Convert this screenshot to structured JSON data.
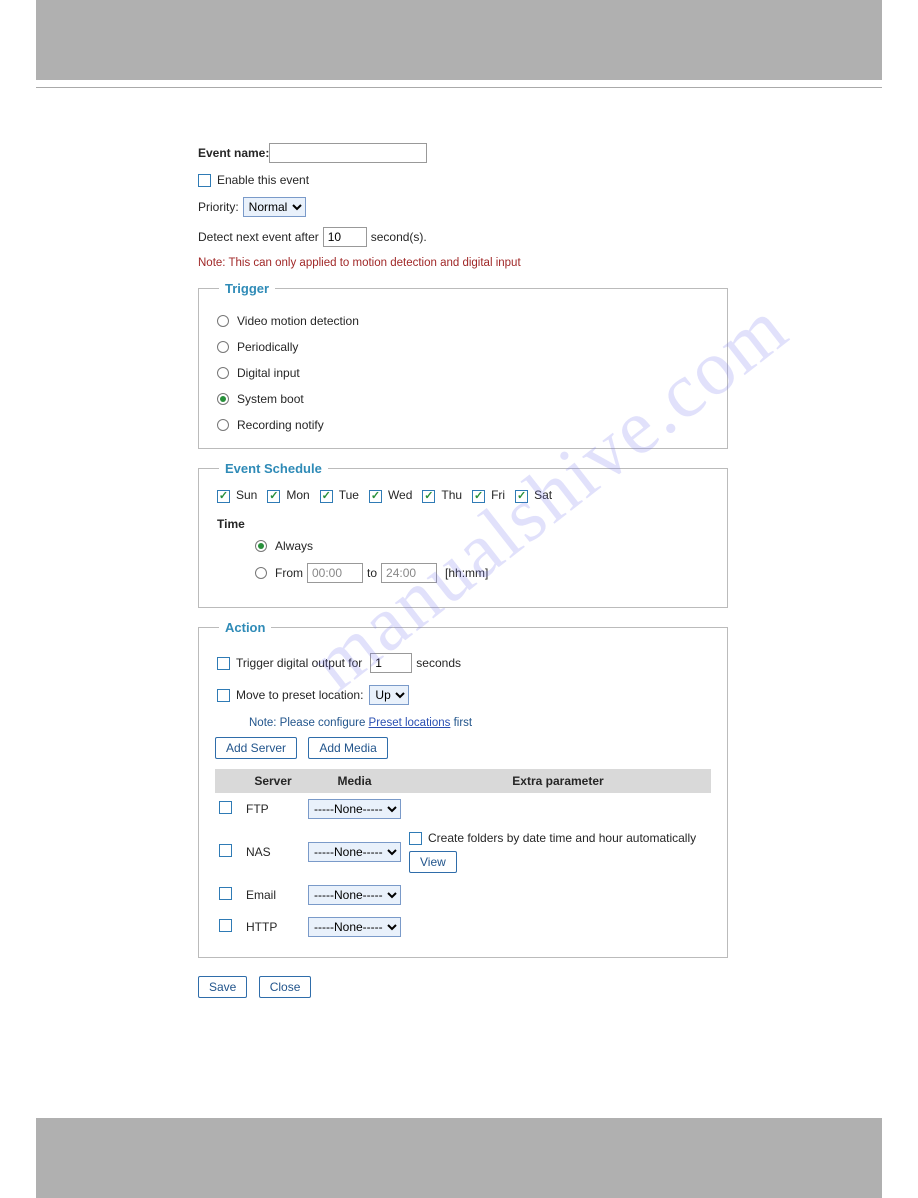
{
  "watermark": "manualshive.com",
  "form": {
    "event_name_label": "Event name:",
    "event_name_value": "",
    "enable_label": "Enable this event",
    "enable_checked": false,
    "priority_label": "Priority:",
    "priority_value": "Normal",
    "detect_prefix": "Detect next event after",
    "detect_value": "10",
    "detect_suffix": "second(s).",
    "note": "Note: This can only applied to motion detection and digital input"
  },
  "trigger": {
    "legend": "Trigger",
    "options": [
      {
        "label": "Video motion detection",
        "selected": false
      },
      {
        "label": "Periodically",
        "selected": false
      },
      {
        "label": "Digital input",
        "selected": false
      },
      {
        "label": "System boot",
        "selected": true
      },
      {
        "label": "Recording notify",
        "selected": false
      }
    ]
  },
  "schedule": {
    "legend": "Event Schedule",
    "days": [
      {
        "label": "Sun",
        "checked": true
      },
      {
        "label": "Mon",
        "checked": true
      },
      {
        "label": "Tue",
        "checked": true
      },
      {
        "label": "Wed",
        "checked": true
      },
      {
        "label": "Thu",
        "checked": true
      },
      {
        "label": "Fri",
        "checked": true
      },
      {
        "label": "Sat",
        "checked": true
      }
    ],
    "time_label": "Time",
    "always_label": "Always",
    "always_selected": true,
    "from_label": "From",
    "from_value": "00:00",
    "to_label": "to",
    "to_value": "24:00",
    "hhmm": "[hh:mm]",
    "from_selected": false
  },
  "action": {
    "legend": "Action",
    "trigger_do_label_prefix": "Trigger digital output for",
    "trigger_do_value": "1",
    "trigger_do_label_suffix": "seconds",
    "trigger_do_checked": false,
    "move_preset_label": "Move to preset location:",
    "move_preset_value": "Up",
    "move_preset_checked": false,
    "preset_note_prefix": "Note: Please configure ",
    "preset_link": "Preset locations",
    "preset_note_suffix": " first",
    "add_server_btn": "Add Server",
    "add_media_btn": "Add Media",
    "headers": {
      "server": "Server",
      "media": "Media",
      "extra": "Extra parameter"
    },
    "rows": [
      {
        "name": "FTP",
        "media": "-----None-----",
        "checked": false
      },
      {
        "name": "NAS",
        "media": "-----None-----",
        "checked": false
      },
      {
        "name": "Email",
        "media": "-----None-----",
        "checked": false
      },
      {
        "name": "HTTP",
        "media": "-----None-----",
        "checked": false
      }
    ],
    "nas_folder_label": "Create folders by date time and hour automatically",
    "nas_folder_checked": false,
    "view_btn": "View"
  },
  "buttons": {
    "save": "Save",
    "close": "Close"
  }
}
